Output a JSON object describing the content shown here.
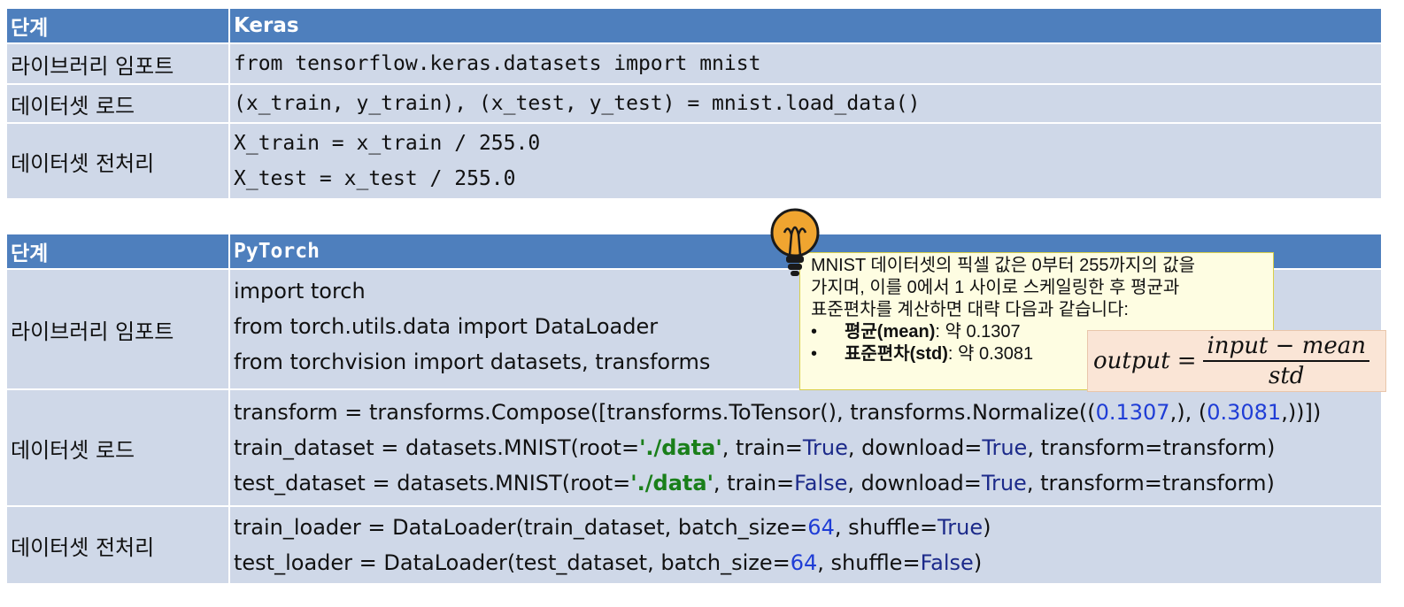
{
  "keras_table": {
    "header": {
      "stage": "단계",
      "framework": "Keras"
    },
    "rows": [
      {
        "stage": "라이브러리 임포트",
        "lines": [
          "from tensorflow.keras.datasets import mnist"
        ]
      },
      {
        "stage": "데이터셋 로드",
        "lines": [
          "(x_train, y_train), (x_test, y_test) = mnist.load_data()"
        ]
      },
      {
        "stage": "데이터셋 전처리",
        "lines": [
          "X_train = x_train / 255.0",
          "X_test = x_test / 255.0"
        ]
      }
    ]
  },
  "pytorch_table": {
    "header": {
      "stage": "단계",
      "framework": "PyTorch"
    },
    "rows": [
      {
        "stage": "라이브러리  임포트",
        "lines": [
          "import torch",
          "from torch.utils.data import DataLoader",
          "from torchvision import datasets, transforms"
        ]
      },
      {
        "stage": "데이터셋  로드",
        "code": {
          "transform": {
            "pre": "transform = transforms.Compose([transforms.ToTensor(), transforms.Normalize((",
            "mean": "0.1307",
            "mid": ",), (",
            "std": "0.3081",
            "post": ",))])"
          },
          "train": {
            "pre": "train_dataset = datasets.MNIST(root=",
            "root": "'./data'",
            "mid1": ", train=",
            "flag": "True",
            "mid2": ", download=",
            "download": "True",
            "post": ", transform=transform)"
          },
          "test": {
            "pre": "test_dataset = datasets.MNIST(root=",
            "root": "'./data'",
            "mid1": ", train=",
            "flag": "False",
            "mid2": ", download=",
            "download": "True",
            "post": ", transform=transform)"
          }
        }
      },
      {
        "stage": "데이터셋  전처리",
        "code": {
          "train": {
            "pre": "train_loader = DataLoader(train_dataset, batch_size=",
            "batch": "64",
            "mid": ", shuffle=",
            "shuffle": "True",
            "post": ")"
          },
          "test": {
            "pre": "test_loader = DataLoader(test_dataset, batch_size=",
            "batch": "64",
            "mid": ", shuffle=",
            "shuffle": "False",
            "post": ")"
          }
        }
      }
    ]
  },
  "tip": {
    "text_lines": [
      "MNIST 데이터셋의 픽셀 값은 0부터 255까지의 값을",
      "가지며, 이를 0에서 1 사이로 스케일링한 후 평균과",
      "표준편차를 계산하면 대략 다음과 같습니다:"
    ],
    "bullets": [
      {
        "symbol": "•",
        "term": "평균(mean)",
        "value": ": 약 0.1307"
      },
      {
        "symbol": "•",
        "term": "표준편차(std)",
        "value": ": 약 0.3081"
      }
    ],
    "icon": "lightbulb-icon"
  },
  "formula": {
    "lhs": "output",
    "eq": "=",
    "numerator": "input − mean",
    "denominator": "std"
  },
  "colors": {
    "header_bg": "#4e7fbd",
    "cell_bg": "#cfd8e8",
    "number": "#1f3dd6",
    "keyword": "#1c2a8a",
    "string": "#1a7f1a",
    "tip_bg": "#fefde2",
    "formula_bg": "#fae5d6"
  }
}
